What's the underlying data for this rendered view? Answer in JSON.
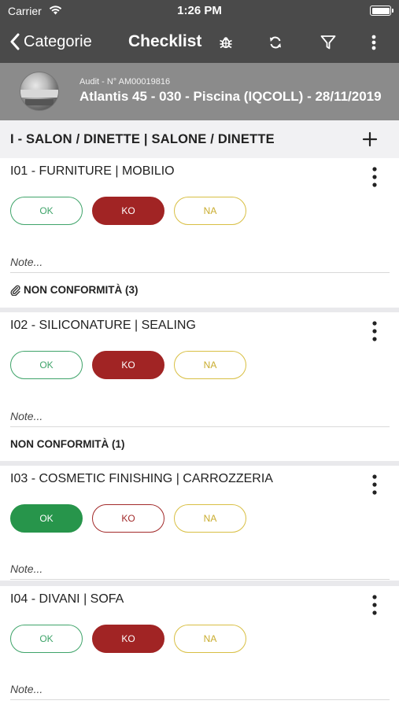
{
  "status_bar": {
    "carrier": "Carrier",
    "time": "1:26 PM"
  },
  "nav": {
    "back_label": "Categorie",
    "title": "Checklist"
  },
  "audit": {
    "subtitle": "Audit - N° AM00019816",
    "title": "Atlantis 45 - 030 - Piscina (IQCOLL) - 28/11/2019"
  },
  "section": {
    "title": "I - SALON / DINETTE | SALONE / DINETTE"
  },
  "labels": {
    "ok": "OK",
    "ko": "KO",
    "na": "NA",
    "note_placeholder": "Note..."
  },
  "items": [
    {
      "title": "I01 - FURNITURE | MOBILIO",
      "selected": "KO",
      "nc_label": "NON CONFORMITÀ (3)",
      "nc_has_attachment": true
    },
    {
      "title": "I02 - SILICONATURE | SEALING",
      "selected": "KO",
      "nc_label": "NON CONFORMITÀ (1)",
      "nc_has_attachment": false
    },
    {
      "title": "I03 - COSMETIC FINISHING | CARROZZERIA",
      "selected": "OK"
    },
    {
      "title": "I04 - DIVANI | SOFA",
      "selected": "KO"
    }
  ],
  "colors": {
    "ok": "#27954b",
    "ko": "#a12424",
    "na": "#d8bf43",
    "bar": "#4a4a4a",
    "audit_bg": "#8b8b8b"
  },
  "icons": [
    "wifi-icon",
    "battery-icon",
    "back-chevron-icon",
    "bug-icon",
    "sync-icon",
    "filter-icon",
    "more-vertical-icon",
    "plus-icon",
    "paperclip-icon"
  ]
}
